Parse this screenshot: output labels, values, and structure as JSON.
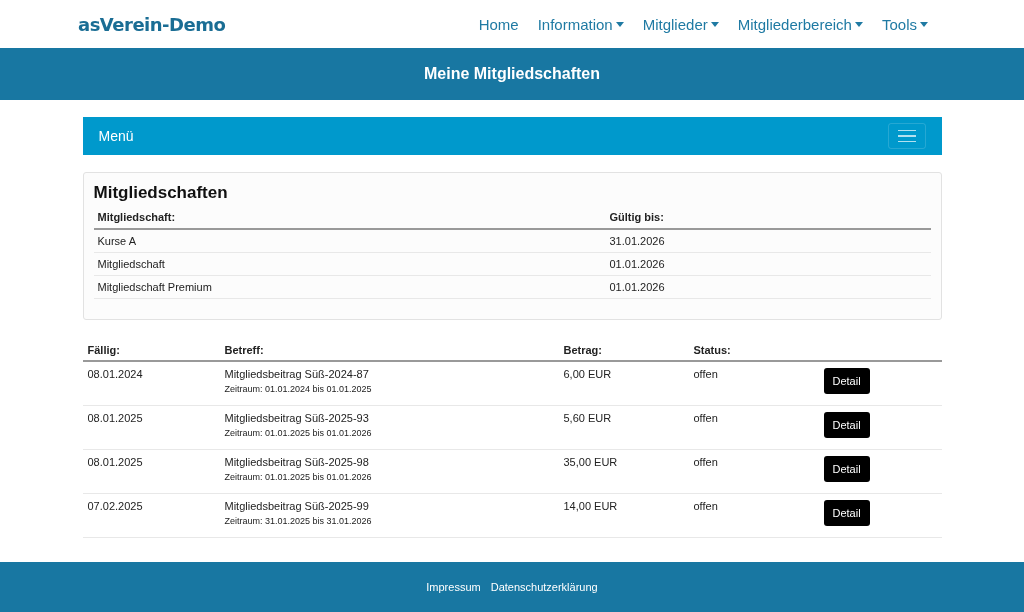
{
  "brand": "asVerein-Demo",
  "nav": [
    {
      "label": "Home",
      "dropdown": false
    },
    {
      "label": "Information",
      "dropdown": true
    },
    {
      "label": "Mitglieder",
      "dropdown": true
    },
    {
      "label": "Mitgliederbereich",
      "dropdown": true
    },
    {
      "label": "Tools",
      "dropdown": true
    }
  ],
  "banner": "Meine Mitgliedschaften",
  "menu_bar": {
    "label": "Menü"
  },
  "memberships": {
    "title": "Mitgliedschaften",
    "columns": [
      "Mitgliedschaft:",
      "Gültig bis:"
    ],
    "rows": [
      [
        "Kurse A",
        "31.01.2026"
      ],
      [
        "Mitgliedschaft",
        "01.01.2026"
      ],
      [
        "Mitgliedschaft Premium",
        "01.01.2026"
      ]
    ]
  },
  "fees": {
    "columns": [
      "Fällig:",
      "Betreff:",
      "Betrag:",
      "Status:"
    ],
    "rows": [
      {
        "due": "08.01.2024",
        "subject": "Mitgliedsbeitrag Süß-2024-87",
        "period": "Zeitraum: 01.01.2024 bis 01.01.2025",
        "amount": "6,00 EUR",
        "status": "offen",
        "button": "Detail"
      },
      {
        "due": "08.01.2025",
        "subject": "Mitgliedsbeitrag Süß-2025-93",
        "period": "Zeitraum: 01.01.2025 bis 01.01.2026",
        "amount": "5,60 EUR",
        "status": "offen",
        "button": "Detail"
      },
      {
        "due": "08.01.2025",
        "subject": "Mitgliedsbeitrag Süß-2025-98",
        "period": "Zeitraum: 01.01.2025 bis 01.01.2026",
        "amount": "35,00 EUR",
        "status": "offen",
        "button": "Detail"
      },
      {
        "due": "07.02.2025",
        "subject": "Mitgliedsbeitrag Süß-2025-99",
        "period": "Zeitraum: 31.01.2025 bis 31.01.2026",
        "amount": "14,00 EUR",
        "status": "offen",
        "button": "Detail"
      }
    ]
  },
  "footer": [
    "Impressum",
    "Datenschutzerklärung"
  ]
}
